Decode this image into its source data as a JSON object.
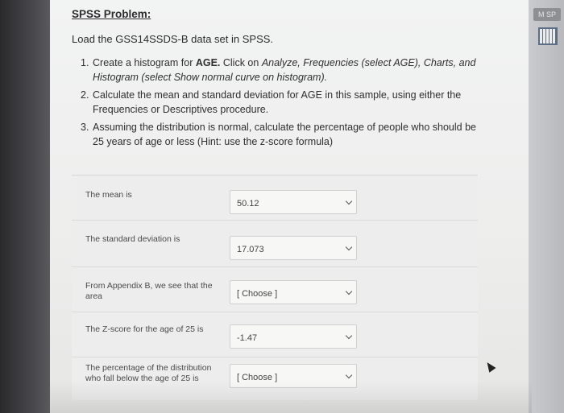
{
  "taskbar": {
    "app_label": "M SP"
  },
  "header": {
    "title": "SPSS Problem:"
  },
  "intro": "Load the GSS14SSDS-B data set in SPSS.",
  "steps": [
    {
      "num": "1.",
      "text_a": "Create a histogram for ",
      "bold": "AGE.",
      "text_b": " Click on ",
      "italic": "Analyze, Frequencies (select AGE), Charts, and Histogram (select Show normal curve on histogram)."
    },
    {
      "num": "2.",
      "text": "Calculate the mean and standard deviation for AGE in this sample, using either the Frequencies or Descriptives procedure."
    },
    {
      "num": "3.",
      "text": "Assuming the distribution is normal, calculate the percentage of people who should be 25 years of age or less (Hint: use the z-score formula)"
    }
  ],
  "questions": [
    {
      "label": "The mean is",
      "value": "50.12"
    },
    {
      "label": "The standard deviation is",
      "value": "17.073"
    },
    {
      "label": "From Appendix B, we see that the area",
      "value": "[ Choose ]"
    },
    {
      "label": "The Z-score for the age of 25 is",
      "value": "-1.47"
    },
    {
      "label": "The percentage of the distribution who fall below the age of 25 is",
      "value": "[ Choose ]"
    }
  ]
}
